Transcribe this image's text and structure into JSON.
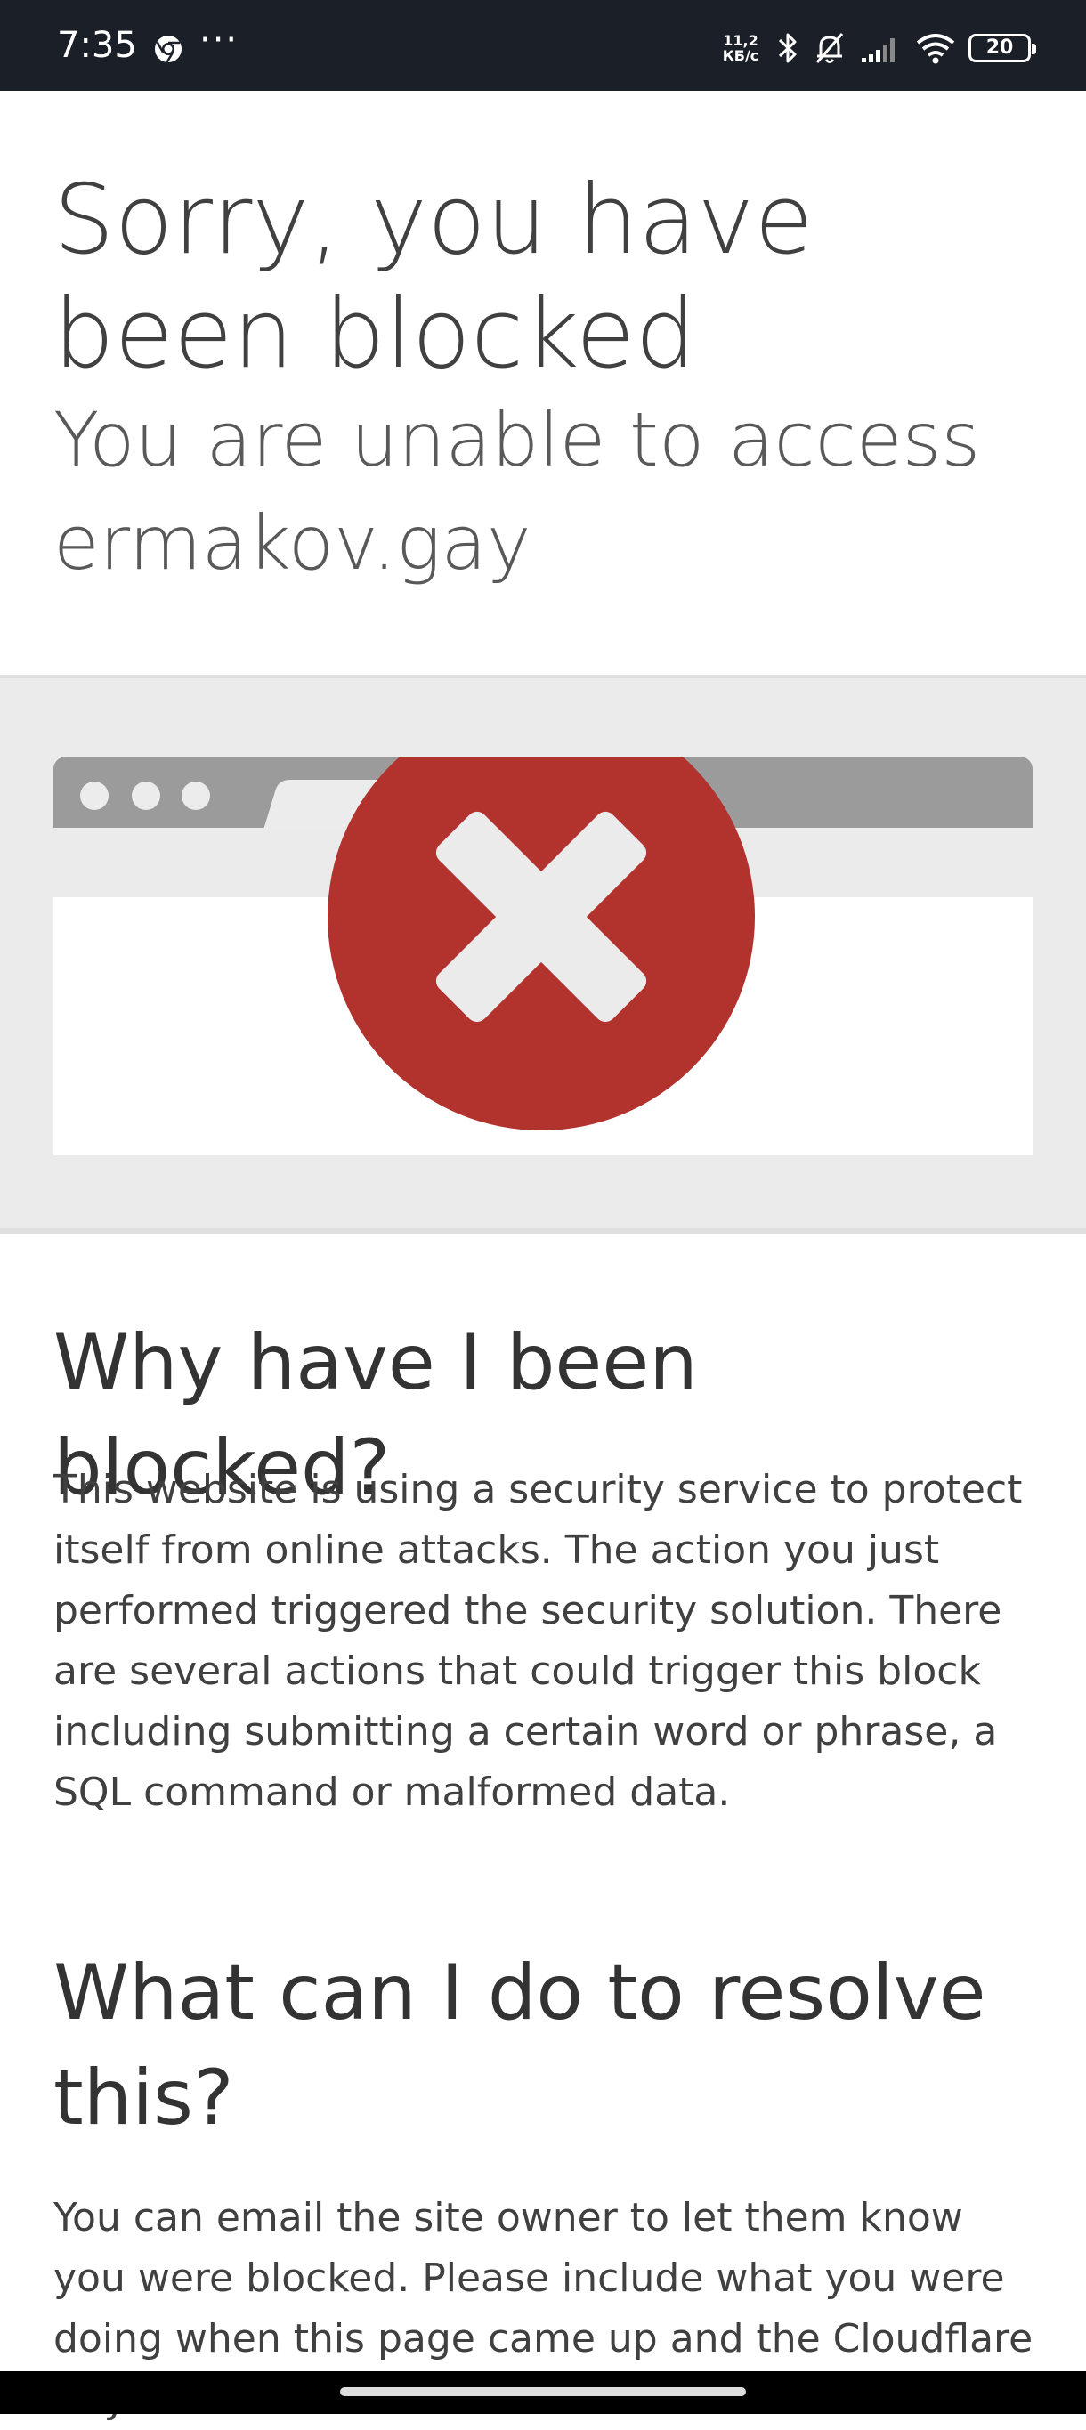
{
  "status_bar": {
    "time": "7:35",
    "chrome_icon": "chrome-icon",
    "more": "···",
    "net_speed_value": "11,2",
    "net_speed_unit": "КБ/с",
    "icons": [
      "bluetooth-icon",
      "bell-off-icon",
      "signal-icon",
      "wifi-icon"
    ],
    "battery": "20"
  },
  "page": {
    "title": "Sorry, you have been blocked",
    "subtitle": "You are unable to access ermakov.gay",
    "section1_heading": "Why have I been blocked?",
    "section1_text": "This website is using a security service to protect itself from online attacks. The action you just performed triggered the security solution. There are several actions that could trigger this block including submitting a certain word or phrase, a SQL command or malformed data.",
    "section2_heading": "What can I do to resolve this?",
    "section2_text": "You can email the site owner to let them know you were blocked. Please include what you were doing when this page came up and the Cloudflare Ray ID"
  },
  "illustration": {
    "icon": "blocked-x-icon",
    "colors": {
      "band": "#ebebeb",
      "browser_bar": "#9b9b9b",
      "circle": "#b2322e",
      "x_mark": "#ebebeb"
    }
  }
}
